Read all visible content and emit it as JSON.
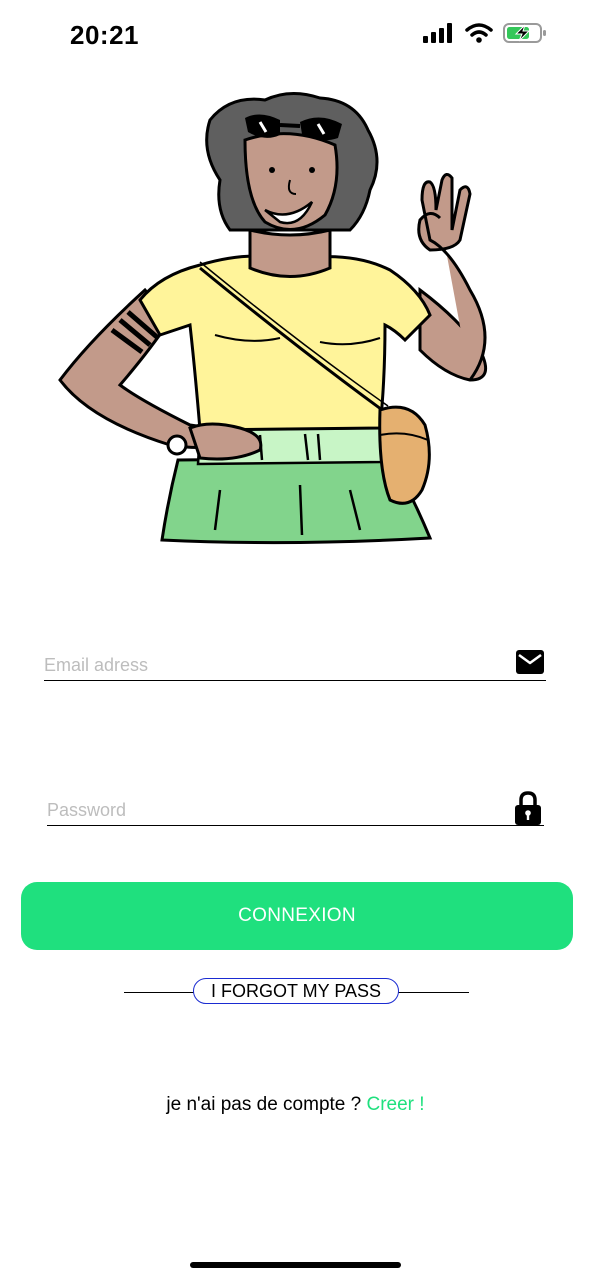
{
  "status_bar": {
    "time": "20:21",
    "icons": [
      "cellular-signal-icon",
      "wifi-icon",
      "battery-charging-icon"
    ]
  },
  "illustration": {
    "name": "woman-ok-gesture-illustration"
  },
  "login_form": {
    "email": {
      "placeholder": "Email adress",
      "value": "",
      "icon": "envelope-icon"
    },
    "password": {
      "placeholder": "Password",
      "value": "",
      "icon": "lock-icon"
    },
    "submit_label": "CONNEXION",
    "forgot_label": "I FORGOT MY PASS"
  },
  "signup": {
    "prompt": "je n'ai pas de compte ? ",
    "link_label": "Creer !"
  },
  "colors": {
    "accent": "#1fe07e",
    "forgot_border": "#1a2bd1"
  }
}
